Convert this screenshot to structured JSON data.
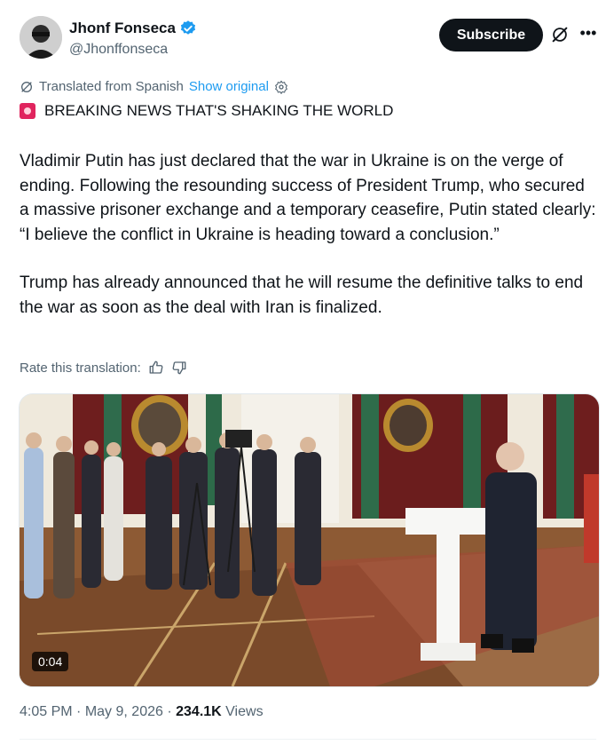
{
  "author": {
    "name": "Jhonf Fonseca",
    "handle": "@Jhonffonseca",
    "verified_color": "#1d9bf0"
  },
  "actions": {
    "subscribe_label": "Subscribe",
    "more_label": "•••"
  },
  "translation": {
    "note": "Translated from Spanish",
    "show_original": "Show original",
    "rate_label": "Rate this translation:"
  },
  "post": {
    "headline": "BREAKING NEWS THAT'S SHAKING THE WORLD",
    "paragraphs": [
      "Vladimir Putin has just declared that the war in Ukraine is on the verge of ending. Following the resounding success of President Trump, who secured a massive prisoner exchange and a temporary ceasefire, Putin stated clearly: “I believe the conflict in Ukraine is heading toward a conclusion.”",
      "Trump has already announced that he will resume the definitive talks to end the war as soon as the deal with Iran is finalized."
    ]
  },
  "media": {
    "duration": "0:04"
  },
  "meta": {
    "time": "4:05 PM",
    "date": "May 9, 2026",
    "views_count": "234.1K",
    "views_label": "Views",
    "sep": "·"
  },
  "colors": {
    "accent": "#1d9bf0",
    "text": "#0f1419",
    "secondary": "#536471"
  }
}
